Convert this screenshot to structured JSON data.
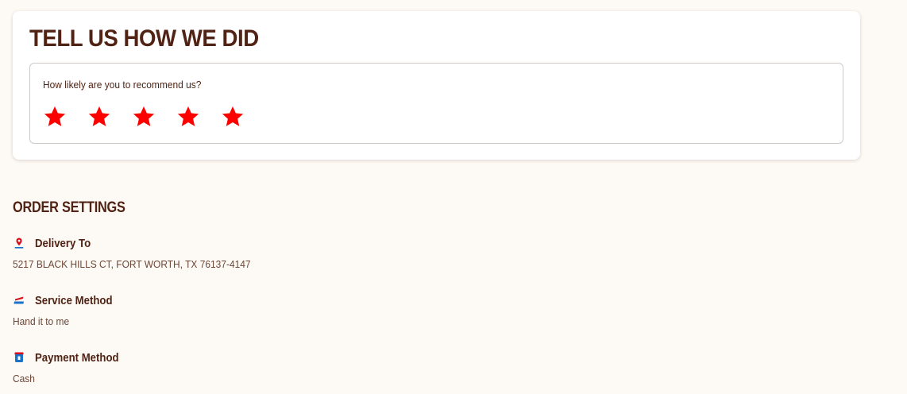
{
  "feedback": {
    "title": "TELL US HOW WE DID",
    "question": "How likely are you to recommend us?",
    "rating": {
      "selected": 5,
      "max": 5,
      "star_color": "#ff0000"
    }
  },
  "order_settings": {
    "title": "ORDER SETTINGS",
    "items": [
      {
        "label": "Delivery To",
        "value": "5217 BLACK HILLS CT, FORT WORTH, TX 76137-4147",
        "icon": "location-pin-icon"
      },
      {
        "label": "Service Method",
        "value": "Hand it to me",
        "icon": "service-method-icon"
      },
      {
        "label": "Payment Method",
        "value": "Cash",
        "icon": "payment-icon"
      }
    ]
  },
  "colors": {
    "brand_brown": "#502314",
    "accent_red": "#d90f1a",
    "accent_blue": "#1a73c8",
    "background": "#fdf9f4"
  }
}
